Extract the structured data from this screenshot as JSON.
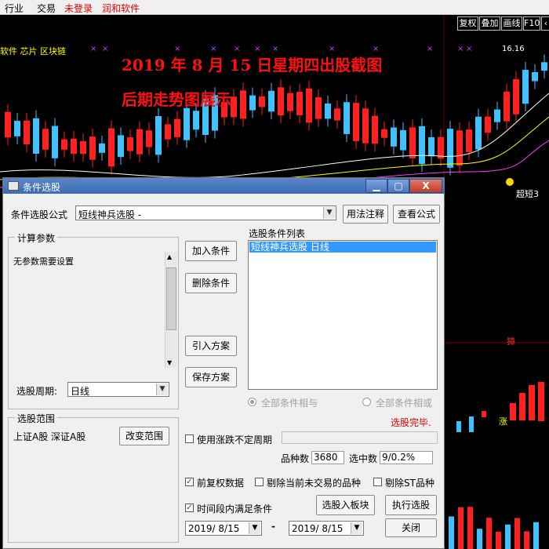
{
  "menubar": {
    "industry": "行业",
    "trade": "交易",
    "login_status": "未登录",
    "software": "润和软件"
  },
  "chart": {
    "toolbar": {
      "restore": "复权",
      "overlay": "叠加",
      "draw": "画线",
      "f10": "F10"
    },
    "ticker": "软件 芯片 区块链",
    "overlay_line1": "2019 年 8 月 15 日星期四出股截图",
    "overlay_line2": "后期走势图展示",
    "price_label": "16.16",
    "signal_label": "超短3",
    "signal_right_label": "獐",
    "bottom_label": "涨",
    "colors": {
      "up": "#ff2020",
      "down": "#40c0ff",
      "ma1": "#ffffff",
      "ma2": "#ffff00",
      "ma3": "#ff40ff"
    }
  },
  "dialog": {
    "title": "条件选股",
    "formula_label": "条件选股公式",
    "formula_value": "短线神兵选股 -",
    "usage_button": "用法注释",
    "view_formula_button": "查看公式",
    "params_group": "计算参数",
    "params_text": "无参数需要设置",
    "period_label": "选股周期:",
    "period_value": "日线",
    "range_group": "选股范围",
    "range_value": "上证A股 深证A股",
    "change_range_button": "改变范围",
    "add_condition_button": "加入条件",
    "delete_condition_button": "删除条件",
    "import_plan_button": "引入方案",
    "save_plan_button": "保存方案",
    "condition_list_label": "选股条件列表",
    "conditions": [
      "短线神兵选股  日线"
    ],
    "logic_and": "全部条件相与",
    "logic_or": "全部条件相或",
    "status_text": "选股完毕.",
    "use_uncertain_label": "使用涨跌不定周期",
    "count_label": "品种数",
    "count_value": "3680",
    "selected_label": "选中数",
    "selected_value": "9/0.2%",
    "forward_adjust_label": "前复权数据",
    "exclude_untraded_label": "剔除当前未交易的品种",
    "exclude_st_label": "剔除ST品种",
    "time_range_label": "时间段内满足条件",
    "to_block_button": "选股入板块",
    "run_button": "执行选股",
    "close_button": "关闭",
    "date_from": "2019/ 8/15",
    "date_separator": "-",
    "date_to": "2019/ 8/15"
  }
}
